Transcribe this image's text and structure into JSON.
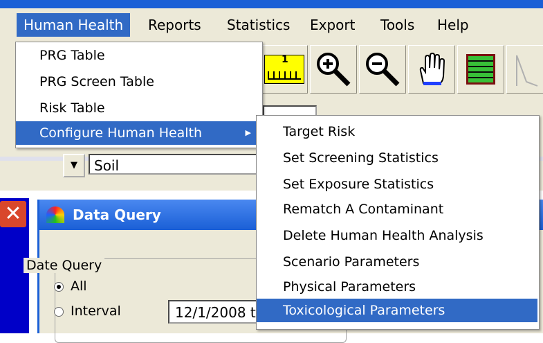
{
  "menubar": {
    "items": [
      {
        "label": "Human Health",
        "active": true
      },
      {
        "label": "Reports"
      },
      {
        "label": "Statistics"
      },
      {
        "label": "Export"
      },
      {
        "label": "Tools"
      },
      {
        "label": "Help"
      }
    ]
  },
  "toolbar": {
    "ruler_number": "1",
    "buttons": [
      "ruler-icon",
      "zoom-in-icon",
      "zoom-out-icon",
      "pan-hand-icon",
      "grid-table-icon"
    ]
  },
  "combo": {
    "value": "Soil"
  },
  "window": {
    "title": "Data Query",
    "group_label": "Date Query",
    "radio_all": "All",
    "radio_interval": "Interval",
    "interval_value": "12/1/2008 t"
  },
  "human_health_menu": {
    "items": [
      "PRG Table",
      "PRG Screen Table",
      "Risk Table",
      "Configure Human Health"
    ]
  },
  "configure_submenu": {
    "items": [
      "Target Risk",
      "Set Screening Statistics",
      "Set Exposure Statistics",
      "Rematch A Contaminant",
      "Delete Human Health Analysis",
      "Scenario Parameters",
      "Physical Parameters",
      "Toxicological Parameters"
    ],
    "highlighted": "Toxicological Parameters"
  },
  "colors": {
    "highlight": "#316ac5",
    "titlebar": "#1a5fd6",
    "chrome": "#ece9d8"
  }
}
